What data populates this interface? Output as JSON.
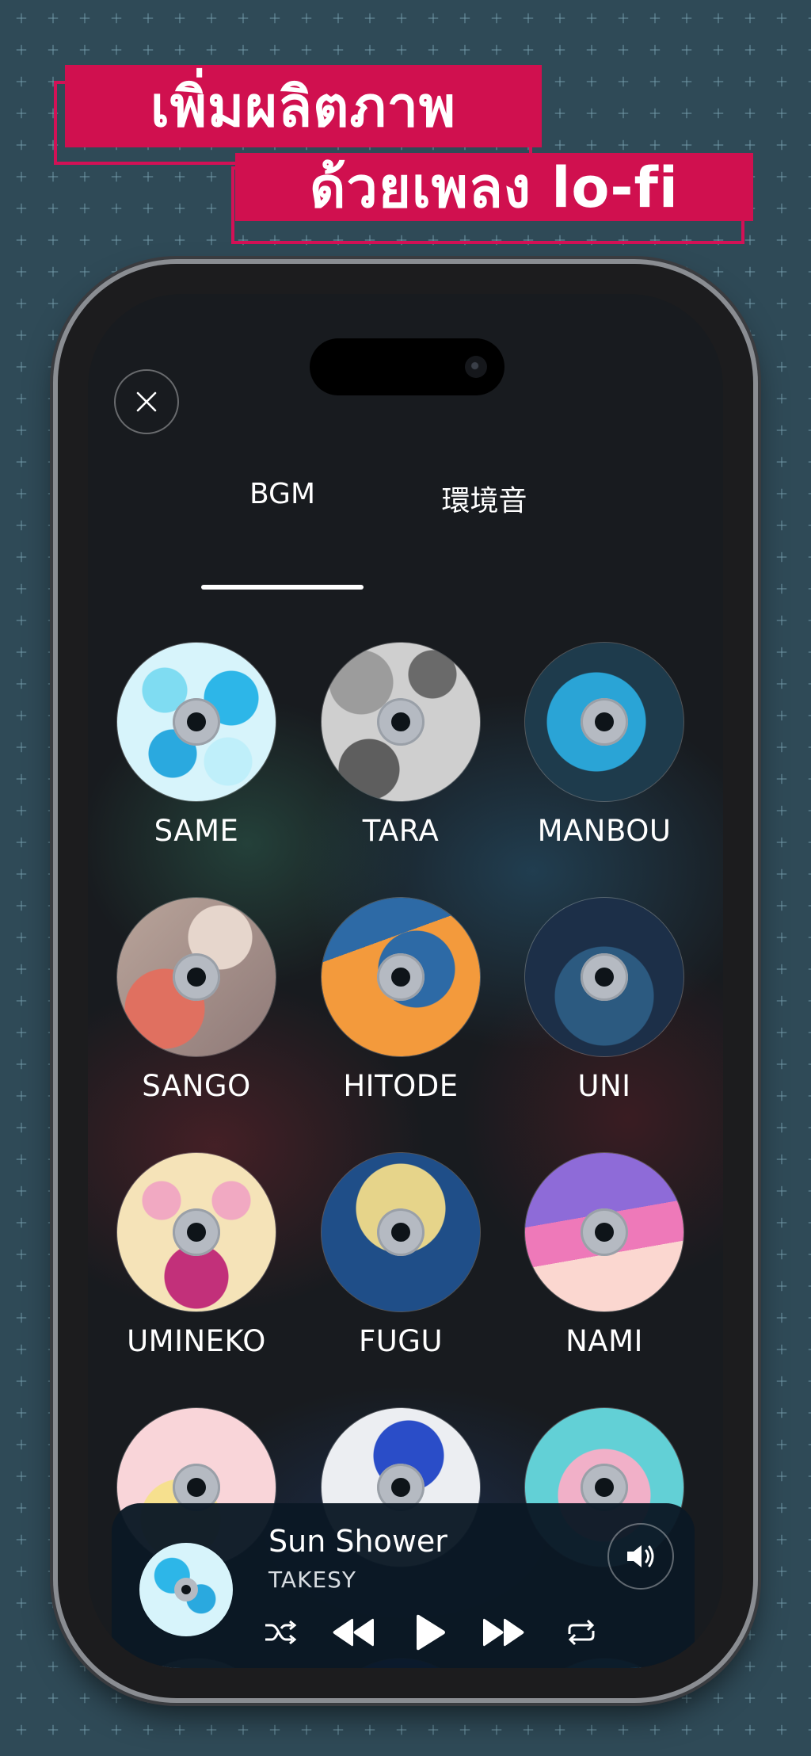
{
  "headline": {
    "line1": "เพิ่มผลิตภาพ",
    "line2": "ด้วยเพลง lo-fi"
  },
  "tabs": [
    {
      "label": "BGM",
      "active": true
    },
    {
      "label": "環境音",
      "active": false
    }
  ],
  "tracks": [
    {
      "label": "SAME"
    },
    {
      "label": "TARA"
    },
    {
      "label": "MANBOU"
    },
    {
      "label": "SANGO"
    },
    {
      "label": "HITODE"
    },
    {
      "label": "UNI"
    },
    {
      "label": "UMINEKO"
    },
    {
      "label": "FUGU"
    },
    {
      "label": "NAMI"
    }
  ],
  "now_playing": {
    "title": "Sun Shower",
    "artist": "TAKESY"
  },
  "icons": {
    "close": "close-icon",
    "volume": "speaker-icon",
    "shuffle": "shuffle-icon",
    "previous": "previous-icon",
    "play": "play-icon",
    "next": "next-icon",
    "repeat": "repeat-icon"
  },
  "colors": {
    "accent": "#d0104f",
    "background": "#10222c",
    "player_bg": "#0a1824"
  }
}
